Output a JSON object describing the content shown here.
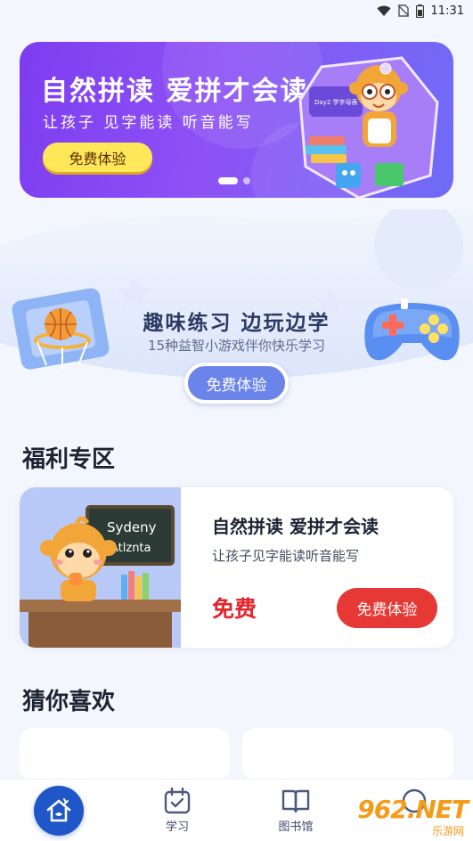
{
  "status_bar": {
    "time": "11:31"
  },
  "banner": {
    "title": "自然拼读 爱拼才会读",
    "subtitle": "让孩子 见字能读 听音能写",
    "button": "免费体验",
    "board_label": "Day2 学字母表",
    "slides": 2,
    "active_slide": 1
  },
  "game_section": {
    "title": "趣味练习  边玩边学",
    "subtitle": "15种益智小游戏伴你快乐学习",
    "button": "免费体验"
  },
  "welfare": {
    "section_title": "福利专区",
    "card": {
      "board_line1": "Sydeny",
      "board_line2": "Atlznta",
      "title": "自然拼读 爱拼才会读",
      "subtitle": "让孩子见字能读听音能写",
      "price": "免费",
      "button": "免费体验"
    }
  },
  "recommend": {
    "section_title": "猜你喜欢"
  },
  "bottom_nav": {
    "items": [
      {
        "label": "首页",
        "icon": "home-icon"
      },
      {
        "label": "学习",
        "icon": "calendar-check-icon"
      },
      {
        "label": "图书馆",
        "icon": "book-icon"
      },
      {
        "label": "我的",
        "icon": "user-icon"
      }
    ]
  },
  "watermark": {
    "text": "962.NET",
    "sub": "乐游网"
  }
}
